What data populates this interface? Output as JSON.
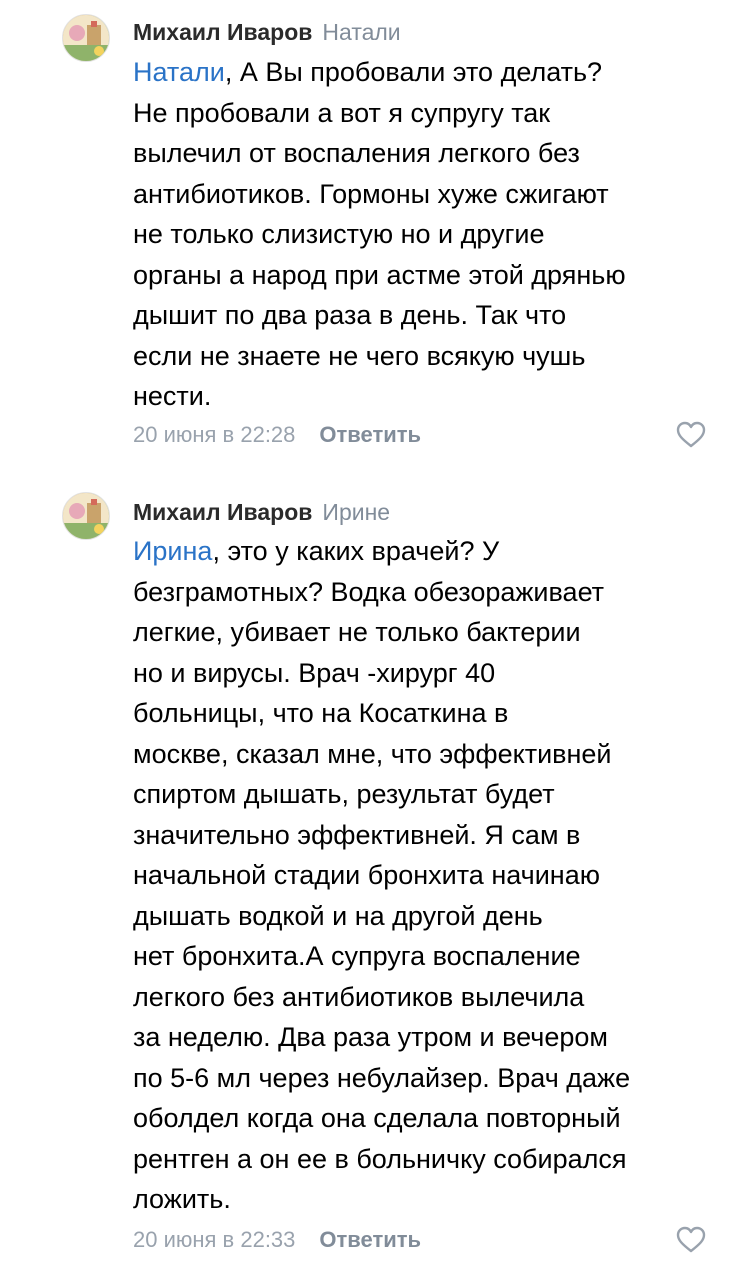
{
  "comments": [
    {
      "author": "Михаил Иваров",
      "reply_to": "Натали",
      "mention": "Натали",
      "text_first_tail": ", А Вы пробовали это делать?",
      "lines": [
        "Не пробовали а вот я супругу так",
        "вылечил от воспаления легкого без",
        "антибиотиков. Гормоны хуже сжигают",
        "не только слизистую но и другие",
        "органы а народ при астме этой дрянью",
        "дышит по два раза в день. Так что",
        "если не знаете не чего всякую чушь",
        "нести."
      ],
      "date": "20 июня в 22:28",
      "reply_label": "Ответить",
      "like_icon": "heart-outline-icon"
    },
    {
      "author": "Михаил Иваров",
      "reply_to": "Ирине",
      "mention": "Ирина",
      "text_first_tail": ", это у каких врачей? У",
      "lines": [
        "безграмотных? Водка обезораживает",
        "легкие, убивает не только бактерии",
        "но и вирусы. Врач -хирург 40",
        "больницы, что на Косаткина в",
        "москве, сказал мне, что эффективней",
        "спиртом дышать, результат будет",
        "значительно эффективней. Я сам в",
        "начальной стадии бронхита начинаю",
        "дышать водкой и на другой день",
        "нет бронхита.А супруга воспаление",
        "легкого без антибиотиков вылечила",
        "за неделю. Два раза утром и вечером",
        "по 5-6 мл через небулайзер. Врач даже",
        "оболдел когда она сделала повторный",
        "рентген а он ее в больничку собирался",
        "ложить."
      ],
      "date": "20 июня в 22:33",
      "reply_label": "Ответить",
      "like_icon": "heart-outline-icon"
    }
  ],
  "colors": {
    "mention": "#2a73c7",
    "secondary": "#818c99",
    "date": "#99a2ad",
    "text": "#000000"
  }
}
